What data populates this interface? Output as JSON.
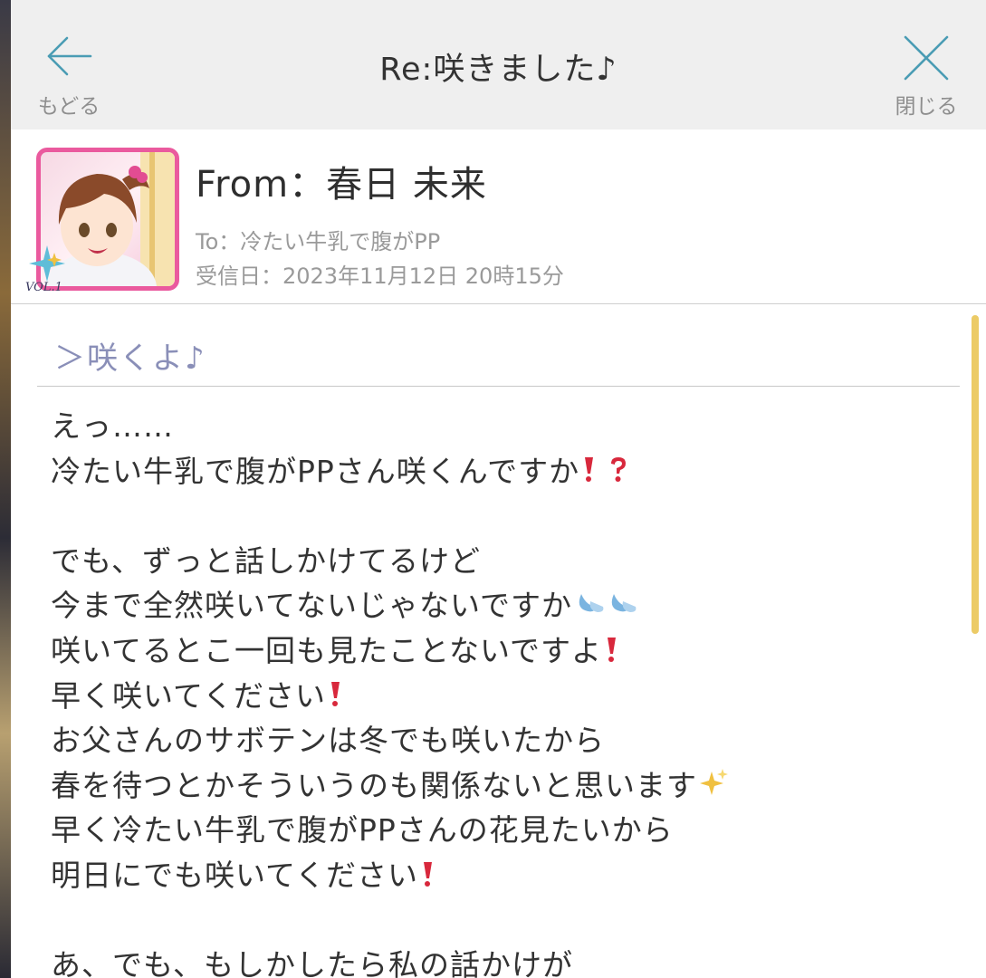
{
  "header": {
    "title": "Re:咲きました♪",
    "back_label": "もどる",
    "close_label": "閉じる"
  },
  "sender": {
    "from": "From：春日 未来",
    "to": "To：冷たい牛乳で腹がPP",
    "received": "受信日：2023年11月12日 20時15分",
    "badge_text": "VOL.1"
  },
  "quote": "＞咲くよ♪",
  "message_lines": [
    {
      "text": "えっ……",
      "emoji": ""
    },
    {
      "text": "冷たい牛乳で腹がPPさん咲くんですか",
      "emoji": "exclamation-question-icon"
    },
    {
      "text": "",
      "emoji": ""
    },
    {
      "text": "でも、ずっと話しかけてるけど",
      "emoji": ""
    },
    {
      "text": "今まで全然咲いてないじゃないですか",
      "emoji": "sweat-drops-icon"
    },
    {
      "text": "咲いてるとこ一回も見たことないですよ",
      "emoji": "exclamation-icon"
    },
    {
      "text": "早く咲いてください",
      "emoji": "exclamation-icon"
    },
    {
      "text": "お父さんのサボテンは冬でも咲いたから",
      "emoji": ""
    },
    {
      "text": "春を待つとかそういうのも関係ないと思います",
      "emoji": "sparkle-icon"
    },
    {
      "text": "早く冷たい牛乳で腹がPPさんの花見たいから",
      "emoji": ""
    },
    {
      "text": "明日にでも咲いてください",
      "emoji": "exclamation-icon"
    },
    {
      "text": "",
      "emoji": ""
    },
    {
      "text": "あ、でも、もしかしたら私の話かけが",
      "emoji": ""
    }
  ],
  "colors": {
    "header_bg": "#efefef",
    "accent_teal": "#4a9cb4",
    "avatar_border": "#ea5a9e",
    "quote_text": "#8a8fb8",
    "scrollbar": "#eccb66",
    "exclamation_red": "#d8283c"
  }
}
